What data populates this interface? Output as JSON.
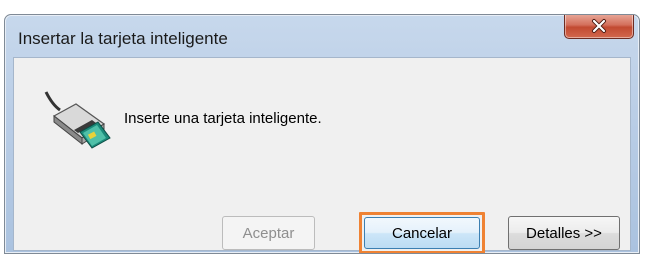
{
  "window": {
    "title": "Insertar la tarjeta inteligente",
    "close_icon": "close-icon"
  },
  "dialog": {
    "icon": "smart-card-reader-icon",
    "message": "Inserte una tarjeta inteligente."
  },
  "buttons": {
    "accept_label": "Aceptar",
    "cancel_label": "Cancelar",
    "details_label": "Detalles >>"
  },
  "colors": {
    "highlight": "#ef8233",
    "close_button": "#c24a31",
    "titlebar": "#b9cde6"
  }
}
